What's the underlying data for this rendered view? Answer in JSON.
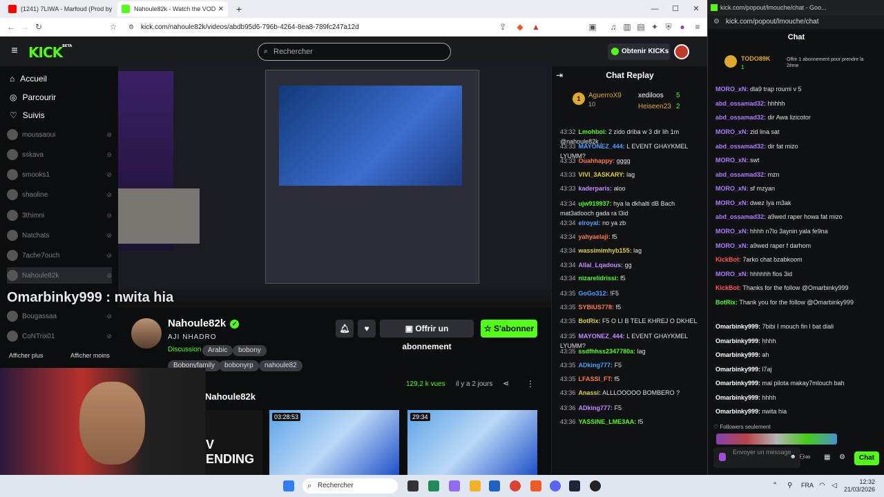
{
  "browser": {
    "tabs": [
      {
        "title": "(1241) 7LIWA - Marfoud (Prod by Eni",
        "active": false
      },
      {
        "title": "Nahoule82k - Watch the VOD",
        "active": true
      }
    ],
    "new_tab": "+",
    "url": "kick.com/nahoule82k/videos/abdb95d6-796b-4264-8ea8-789fc247a12d",
    "win_min": "—",
    "win_max": "☐",
    "win_close": "✕"
  },
  "kick": {
    "logo": "KICK",
    "logo_beta": "BETA",
    "search_placeholder": "Rechercher",
    "get_kicks": "Obtenir KICKs",
    "sidebar": {
      "main": [
        {
          "label": "Accueil",
          "icon": "home-icon"
        },
        {
          "label": "Parcourir",
          "icon": "browse-icon"
        },
        {
          "label": "Suivis",
          "icon": "heart-icon"
        }
      ],
      "channels": [
        "moussaoui",
        "sskava",
        "smooks1",
        "shaoline",
        "3thimni",
        "Natchats",
        "7ache7ouch",
        "Nahoule82k",
        "Bougassaa",
        "CoNTrix01"
      ],
      "show_more": "Afficher plus",
      "show_less": "Afficher moins"
    },
    "player_overlay_text": "Omarbinky999 : nwita hia",
    "channel": {
      "name": "Nahoule82k",
      "subtitle": "AJI NHADRO",
      "category": "Discussion",
      "tags": [
        "Arabic",
        "bobony",
        "Bobonyfamily",
        "bobonyrp",
        "nahoule82"
      ],
      "gift_button": "Offrir un abonnement",
      "subscribe_button": "S'abonner",
      "views": "129,2 k vues",
      "ago": "il y a 2 jours",
      "dots": "⋮",
      "share": "⋖"
    },
    "related": {
      "title": "Nahoule82k",
      "first_text": "V ENDING",
      "thumbs": [
        {
          "duration": "03:28:53"
        },
        {
          "duration": "29:34"
        }
      ]
    },
    "chat_replay": {
      "title": "Chat Replay",
      "top": [
        {
          "rank": "1",
          "name": "AguerroX9",
          "count": "10"
        },
        {
          "name": "xediloos",
          "count": "5"
        },
        {
          "name": "Heiseen23",
          "count": "2"
        }
      ],
      "messages": [
        {
          "t": "43:32",
          "user": "Lmohboi:",
          "text": "2 zido driba w 3 dir lih 1m @nahoule82k ."
        },
        {
          "t": "43:33",
          "user": "MAYONEZ_444:",
          "text": "L EVENT GHAYKMEL LYUMM?"
        },
        {
          "t": "43:33",
          "user": "Ouahhappy:",
          "text": "gggg"
        },
        {
          "t": "43:33",
          "user": "VIVI_3ASKARY:",
          "text": "lag"
        },
        {
          "t": "43:33",
          "user": "kaderparis:",
          "text": "aloo"
        },
        {
          "t": "43:34",
          "user": "ujw919937:",
          "text": "hya la dkhalti dB Bach mat3atlooch gada ra l3id"
        },
        {
          "t": "43:34",
          "user": "elroyal:",
          "text": "no ya zb"
        },
        {
          "t": "43:34",
          "user": "yahyaelaji:",
          "text": "f5"
        },
        {
          "t": "43:34",
          "user": "wassimimhyb155:",
          "text": "lag"
        },
        {
          "t": "43:34",
          "user": "Allal_Lqadous:",
          "text": "gg"
        },
        {
          "t": "43:34",
          "user": "nizarelidrissi:",
          "text": "f5"
        },
        {
          "t": "43:35",
          "user": "GoGo312:",
          "text": "!F5"
        },
        {
          "t": "43:35",
          "user": "SYBIUS778:",
          "text": "f5"
        },
        {
          "t": "43:35",
          "user": "BotRix:",
          "text": "F5 O LI B TELE KHREJ O DKHEL"
        },
        {
          "t": "43:35",
          "user": "MAYONEZ_444:",
          "text": "L EVENT GHAYKMEL LYUMM?"
        },
        {
          "t": "43:35",
          "user": "ssdfhhss2347780a:",
          "text": "lag"
        },
        {
          "t": "43:35",
          "user": "ADking777:",
          "text": "F5"
        },
        {
          "t": "43:35",
          "user": "LFASSI_FT:",
          "text": "f5"
        },
        {
          "t": "43:36",
          "user": "Anassi:",
          "text": "ALLLOOOOO BOMBERO ?"
        },
        {
          "t": "43:36",
          "user": "ADking777:",
          "text": "F5"
        },
        {
          "t": "43:36",
          "user": "YASSINE_LME3AA:",
          "text": "f5"
        }
      ]
    }
  },
  "popout": {
    "tab_title": "kick.com/popout/lmouche/chat - Goo...",
    "url": "kick.com/popout/lmouche/chat",
    "header": "Chat",
    "top_gifter": {
      "name": "TODO89K",
      "count": "1",
      "note": "Offrir 1 abonnement pour prendre la 2ème"
    },
    "messages": [
      {
        "user": "MORO_xN:",
        "text": "dla9 trap roumi v 5",
        "cls": "u1"
      },
      {
        "user": "abd_ossamad32:",
        "text": "hhhhh",
        "cls": "u1"
      },
      {
        "user": "abd_ossamad32:",
        "text": "dir Awa lizicotor",
        "cls": "u1"
      },
      {
        "user": "MORO_xN:",
        "text": "zid lina sat",
        "cls": "u1"
      },
      {
        "user": "abd_ossamad32:",
        "text": "dir fat mizo",
        "cls": "u1"
      },
      {
        "user": "MORO_xN:",
        "text": "swt",
        "cls": "u1"
      },
      {
        "user": "abd_ossamad32:",
        "text": "mzn",
        "cls": "u1"
      },
      {
        "user": "MORO_xN:",
        "text": "sf mzyan",
        "cls": "u1"
      },
      {
        "user": "MORO_xN:",
        "text": "dwez lya m3ak",
        "cls": "u1"
      },
      {
        "user": "abd_ossamad32:",
        "text": "a9wed raper howa fat mizo",
        "cls": "u1"
      },
      {
        "user": "MORO_xN:",
        "text": "hhhh n7lo 3aynin yala fe9na",
        "cls": "u1"
      },
      {
        "user": "MORO_xN:",
        "text": "a9wed raper f darhom",
        "cls": "u1"
      },
      {
        "user": "KickBot:",
        "text": "7arko chat bzabkoom",
        "cls": "u3"
      },
      {
        "user": "MORO_xN:",
        "text": "hhhhhh flos 3id",
        "cls": "u1"
      },
      {
        "user": "KickBot:",
        "text": "Thanks for the follow @Omarbinky999",
        "cls": "u3"
      },
      {
        "user": "BotRix:",
        "text": "Thank you for the follow @Omarbinky999",
        "cls": "u4"
      },
      {
        "user": "Omarbinky999:",
        "text": "7bibi I mouch fin l bat diali",
        "cls": "u2"
      },
      {
        "user": "Omarbinky999:",
        "text": "hhhh",
        "cls": "u2"
      },
      {
        "user": "Omarbinky999:",
        "text": "ah",
        "cls": "u2"
      },
      {
        "user": "Omarbinky999:",
        "text": "l7aj",
        "cls": "u2"
      },
      {
        "user": "Omarbinky999:",
        "text": "mai pilota makay7mlouch bah",
        "cls": "u2"
      },
      {
        "user": "Omarbinky999:",
        "text": "hhhh",
        "cls": "u2"
      },
      {
        "user": "Omarbinky999:",
        "text": "nwita hia",
        "cls": "u2"
      }
    ],
    "followers_only": "Followers seulement",
    "input_placeholder": "Envoyer un message",
    "chat_button": "Chat"
  },
  "taskbar": {
    "search": "Rechercher",
    "lang": "FRA",
    "time": "12:32",
    "date": "21/03/2026"
  },
  "colors": {
    "kick_green": "#53fc18",
    "bg": "#0b0e0f"
  }
}
